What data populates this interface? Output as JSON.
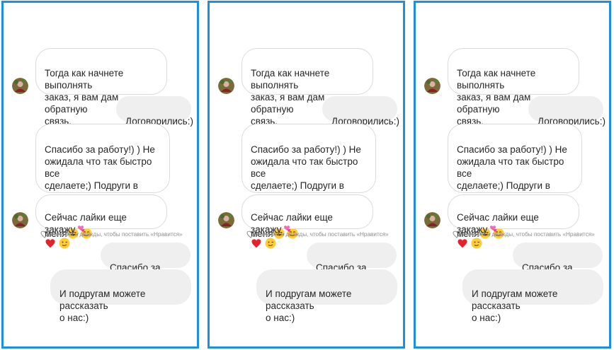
{
  "chat": {
    "messages": [
      {
        "direction": "incoming",
        "text": "Тогда как начнете выполнять\nзаказ, я вам дам обратную\nсвязь."
      },
      {
        "direction": "outgoing",
        "text": "Договорились:)"
      },
      {
        "direction": "incoming",
        "text": "Спасибо за работу!) ) Не\nожидала что так быстро все\nсделаете;) Подруги в шоке от\nколичества подписчиков у\nменя",
        "emojis": [
          "laughing-face",
          "smiling-face"
        ]
      },
      {
        "direction": "incoming",
        "text": "Сейчас лайки еще закажу",
        "emojis": [
          "pink-hearts",
          "red-heart",
          "winking-face"
        ]
      },
      {
        "direction": "outgoing",
        "text": "Спасибо за отзыв:)"
      },
      {
        "direction": "outgoing",
        "text": "И подругам можете рассказать\nо нас:)"
      }
    ],
    "like_hint": "Коснитесь дважды, чтобы поставить «Нравится»"
  },
  "colors": {
    "panel_border": "#1a8fe3",
    "incoming_border": "#dbdbdb",
    "outgoing_bg": "#efefef",
    "hint_text": "#8e8e8e"
  }
}
